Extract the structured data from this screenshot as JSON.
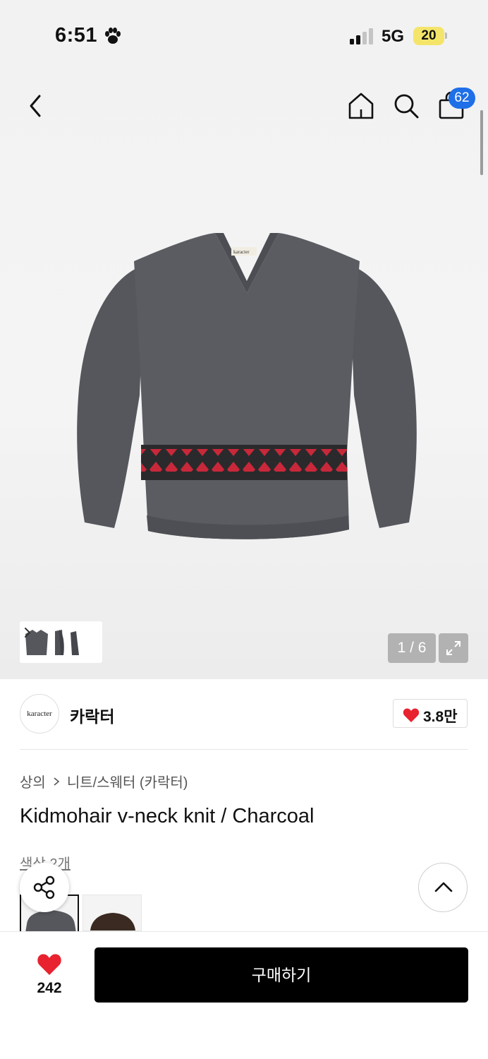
{
  "status_bar": {
    "time": "6:51",
    "network": "5G",
    "battery": "20"
  },
  "header": {
    "cart_count": "62",
    "icons": [
      "back-icon",
      "home-icon",
      "search-icon",
      "shopping-bag-icon"
    ]
  },
  "gallery": {
    "page_counter": "1 / 6",
    "label_on_garment": "karacter",
    "colors": {
      "sweater": "#55575c",
      "stripe_red": "#c8283a",
      "stripe_dark": "#2a2a2c"
    }
  },
  "brand": {
    "logo_text": "karacter",
    "name": "카락터",
    "likes": "3.8만"
  },
  "product": {
    "breadcrumb": [
      "상의",
      "니트/스웨터 (카락터)"
    ],
    "title": "Kidmohair v-neck knit / Charcoal",
    "color_count": "색상 2개"
  },
  "bottom_bar": {
    "wish_count": "242",
    "buy_label": "구매하기"
  },
  "accent_colors": {
    "heart": "#e8222e",
    "badge": "#1e6fe8",
    "buy_button": "#000000"
  }
}
